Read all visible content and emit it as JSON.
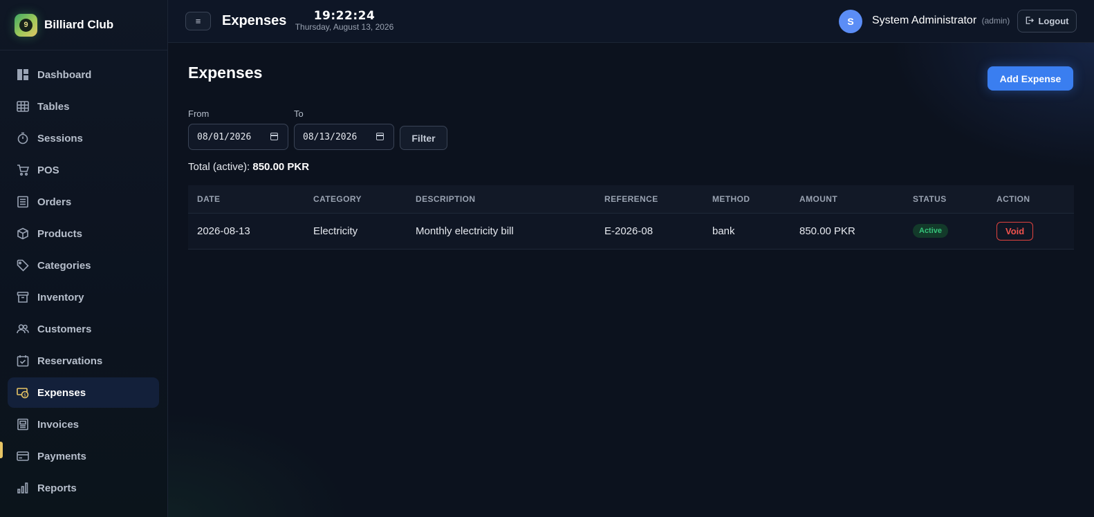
{
  "brand": {
    "name": "Billiard Club",
    "logo_glyph": "9"
  },
  "sidebar": {
    "items": [
      {
        "label": "Dashboard",
        "icon": "dashboard-icon"
      },
      {
        "label": "Tables",
        "icon": "table-grid-icon"
      },
      {
        "label": "Sessions",
        "icon": "stopwatch-icon"
      },
      {
        "label": "POS",
        "icon": "cart-icon"
      },
      {
        "label": "Orders",
        "icon": "receipt-icon"
      },
      {
        "label": "Products",
        "icon": "box-icon"
      },
      {
        "label": "Categories",
        "icon": "tag-icon"
      },
      {
        "label": "Inventory",
        "icon": "archive-icon"
      },
      {
        "label": "Customers",
        "icon": "users-icon"
      },
      {
        "label": "Reservations",
        "icon": "calendar-check-icon"
      },
      {
        "label": "Expenses",
        "icon": "money-icon",
        "active": true
      },
      {
        "label": "Invoices",
        "icon": "invoice-icon"
      },
      {
        "label": "Payments",
        "icon": "card-icon"
      },
      {
        "label": "Reports",
        "icon": "bar-chart-icon"
      }
    ],
    "active_color": "#e8c565"
  },
  "header": {
    "menu_glyph": "≡",
    "title": "Expenses",
    "time": "19:22:24",
    "date": "Thursday, August 13, 2026",
    "avatar_initial": "S",
    "user_name": "System Administrator",
    "user_role": "(admin)",
    "logout_label": "Logout"
  },
  "main": {
    "title": "Expenses",
    "add_button": "Add Expense",
    "filter": {
      "from_label": "From",
      "from_value": "08/01/2026",
      "to_label": "To",
      "to_value": "08/13/2026",
      "button": "Filter"
    },
    "total_label": "Total (active):",
    "total_value": "850.00 PKR",
    "table": {
      "columns": [
        "DATE",
        "CATEGORY",
        "DESCRIPTION",
        "REFERENCE",
        "METHOD",
        "AMOUNT",
        "STATUS",
        "ACTION"
      ],
      "rows": [
        {
          "date": "2026-08-13",
          "category": "Electricity",
          "description": "Monthly electricity bill",
          "reference": "E-2026-08",
          "method": "bank",
          "amount": "850.00 PKR",
          "status": "Active",
          "action": "Void"
        }
      ]
    }
  },
  "colors": {
    "accent": "#3a7ef0",
    "status_active": "#35c37a",
    "void": "#e0433f"
  }
}
